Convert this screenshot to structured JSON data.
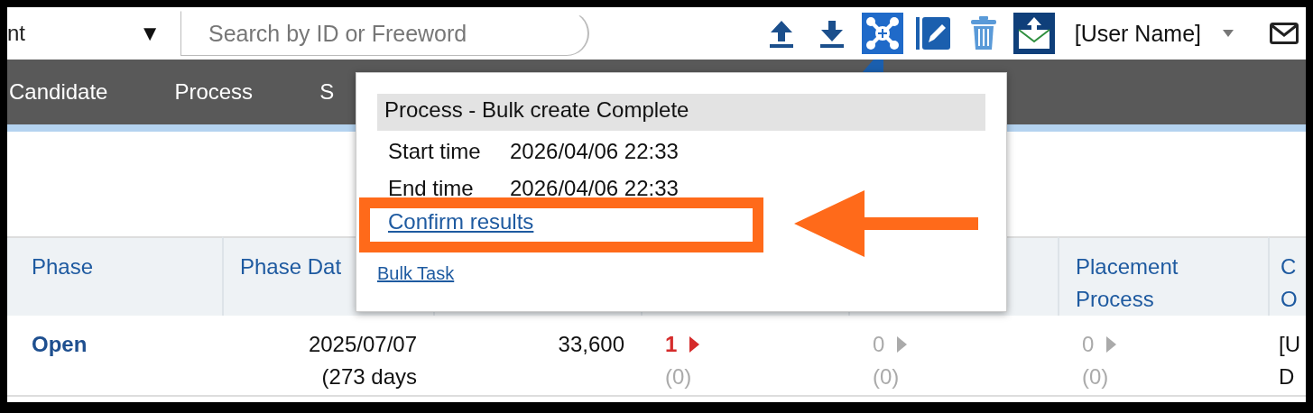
{
  "filter": {
    "value": "nt",
    "caret": "▼"
  },
  "search": {
    "placeholder": "Search by ID or Freeword"
  },
  "toolbar": [
    {
      "kind": "upload",
      "selected": false
    },
    {
      "kind": "download",
      "selected": false
    },
    {
      "kind": "bulk-create",
      "selected": true
    },
    {
      "kind": "edit",
      "selected": false
    },
    {
      "kind": "trash",
      "selected": false
    },
    {
      "kind": "mail-send",
      "selected": false
    }
  ],
  "user": {
    "name": "[User Name]"
  },
  "nav": [
    {
      "label": "Candidate"
    },
    {
      "label": "Process"
    },
    {
      "label": "S"
    }
  ],
  "popup": {
    "title": "Process - Bulk create Complete",
    "rows": [
      {
        "label": "Start time",
        "value": "2026/04/06 22:33"
      },
      {
        "label": "End time",
        "value": "2026/04/06 22:33"
      }
    ],
    "link": "Confirm results",
    "footer_link": "Bulk Task"
  },
  "table": {
    "columns": [
      {
        "lines": [
          "Phase"
        ]
      },
      {
        "lines": [
          "Phase Dat"
        ]
      },
      {},
      {},
      {},
      {
        "lines": [
          "Placement",
          "Process"
        ]
      },
      {
        "lines": [
          "C",
          "O"
        ]
      }
    ],
    "rows": [
      [
        {
          "kind": "phase",
          "lines": [
            "Open"
          ]
        },
        {
          "kind": "date",
          "lines": [
            "2025/07/07",
            "(273 days"
          ]
        },
        {
          "kind": "number",
          "lines": [
            "33,600"
          ]
        },
        {
          "kind": "count",
          "count": "1",
          "sub": "(0)",
          "highlighted": true
        },
        {
          "kind": "count",
          "count": "0",
          "sub": "(0)",
          "highlighted": false
        },
        {
          "kind": "count",
          "count": "0",
          "sub": "(0)",
          "highlighted": false
        },
        {
          "kind": "text",
          "lines": [
            "[U",
            "D"
          ]
        }
      ]
    ]
  }
}
